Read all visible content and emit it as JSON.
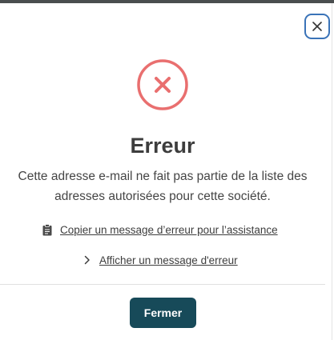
{
  "dialog": {
    "title": "Erreur",
    "message_line1": "Cette adresse e-mail ne fait pas partie de la liste des",
    "message_line2": "adresses autorisées pour cette société.",
    "copy_link": "Copier un message d’erreur pour l’assistance",
    "show_error_link": "Afficher un message d'erreur",
    "close_button_label": "Fermer"
  },
  "icons": {
    "close": "close-icon",
    "error": "error-circle-x-icon",
    "copy": "clipboard-icon",
    "expand": "chevron-right-icon"
  },
  "colors": {
    "error_accent": "#e96f6f",
    "primary_button": "#174a59",
    "close_button_border": "#3a73b8",
    "title_text": "#3d3d3d"
  }
}
